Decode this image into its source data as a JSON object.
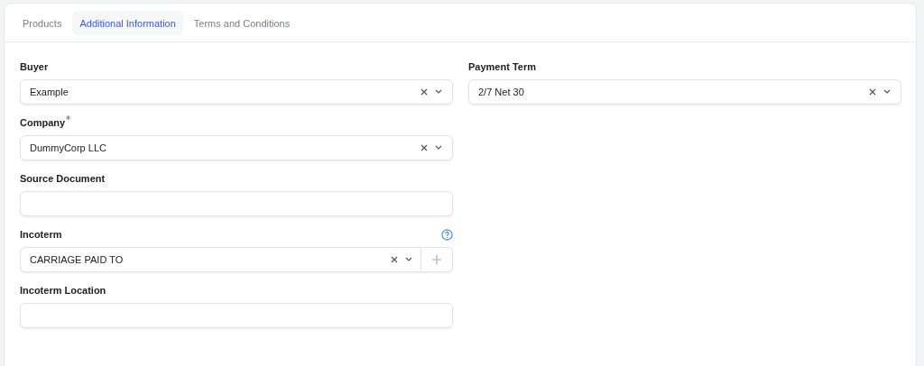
{
  "tabs": [
    {
      "label": "Products",
      "selected": false
    },
    {
      "label": "Additional Information",
      "selected": true
    },
    {
      "label": "Terms and Conditions",
      "selected": false
    }
  ],
  "left_fields": [
    {
      "label": "Buyer",
      "kind": "select",
      "value": "Example",
      "required": false,
      "help": false
    },
    {
      "label": "Company",
      "kind": "select",
      "value": "DummyCorp LLC",
      "required": true,
      "help": false
    },
    {
      "label": "Source Document",
      "kind": "text",
      "required": false,
      "help": false
    },
    {
      "label": "Incoterm",
      "kind": "select_create",
      "value": "CARRIAGE PAID TO",
      "required": false,
      "help": true
    },
    {
      "label": "Incoterm Location",
      "kind": "text",
      "required": false,
      "help": false
    }
  ],
  "right_fields": [
    {
      "label": "Payment Term",
      "kind": "select",
      "value": "2/7 Net 30",
      "required": false,
      "help": false
    }
  ]
}
